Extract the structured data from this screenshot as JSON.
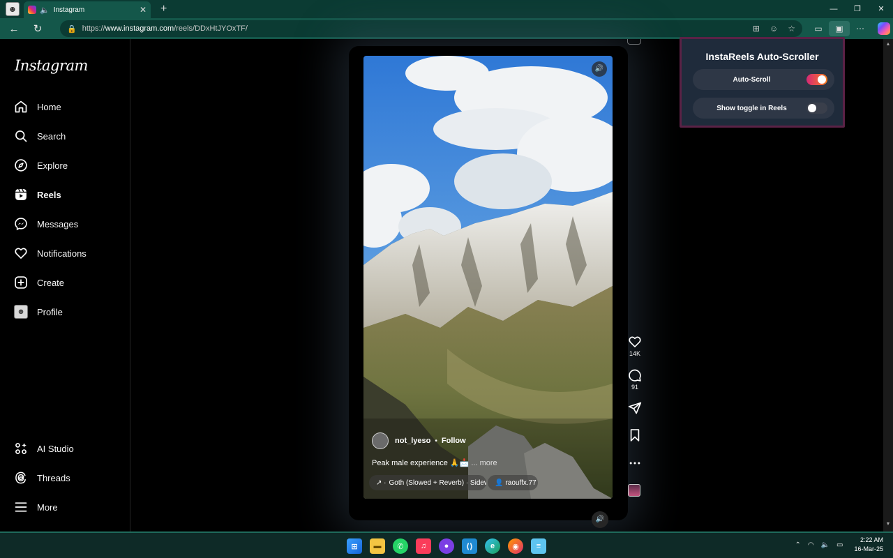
{
  "browser": {
    "tab_title": "Instagram",
    "url_prefix": "https://",
    "url_host": "www.instagram.com",
    "url_path": "/reels/DDxHtJYOxTF/",
    "window_controls": [
      "minimize",
      "restore",
      "close"
    ]
  },
  "sidebar": {
    "logo": "Instagram",
    "items": [
      {
        "label": "Home",
        "icon": "home-icon"
      },
      {
        "label": "Search",
        "icon": "search-icon"
      },
      {
        "label": "Explore",
        "icon": "compass-icon"
      },
      {
        "label": "Reels",
        "icon": "reels-icon",
        "active": true
      },
      {
        "label": "Messages",
        "icon": "messenger-icon"
      },
      {
        "label": "Notifications",
        "icon": "heart-icon"
      },
      {
        "label": "Create",
        "icon": "plus-square-icon"
      },
      {
        "label": "Profile",
        "icon": "profile-avatar"
      },
      {
        "label": "AI Studio",
        "icon": "ai-studio-icon"
      },
      {
        "label": "Threads",
        "icon": "threads-icon"
      },
      {
        "label": "More",
        "icon": "menu-icon"
      }
    ]
  },
  "reel": {
    "username": "not_lyeso",
    "separator": "•",
    "follow": "Follow",
    "caption": "Peak male experience 🙏📩",
    "more": "... more",
    "music": "Goth (Slowed + Reverb) · Sidewalks and Skeletons",
    "music_prefix": "↗ ·",
    "tagged_user": "raouffx.77",
    "likes": "14K",
    "comments": "91"
  },
  "extension_popup": {
    "title": "InstaReels Auto-Scroller",
    "auto_scroll_label": "Auto-Scroll",
    "auto_scroll_on": true,
    "show_toggle_label": "Show toggle in Reels",
    "show_toggle_on": false
  },
  "taskbar": {
    "time": "2:22 AM",
    "date": "16-Mar-25",
    "apps": [
      "windows-start",
      "file-explorer",
      "whatsapp",
      "apple-music",
      "github-desktop",
      "vscode",
      "edge",
      "firefox",
      "notepad"
    ]
  },
  "colors": {
    "browser_frame": "#14574a",
    "ig_gradient_start": "#d62976",
    "ig_gradient_end": "#fa7e1e",
    "popup_bg": "#1f2b3b"
  }
}
